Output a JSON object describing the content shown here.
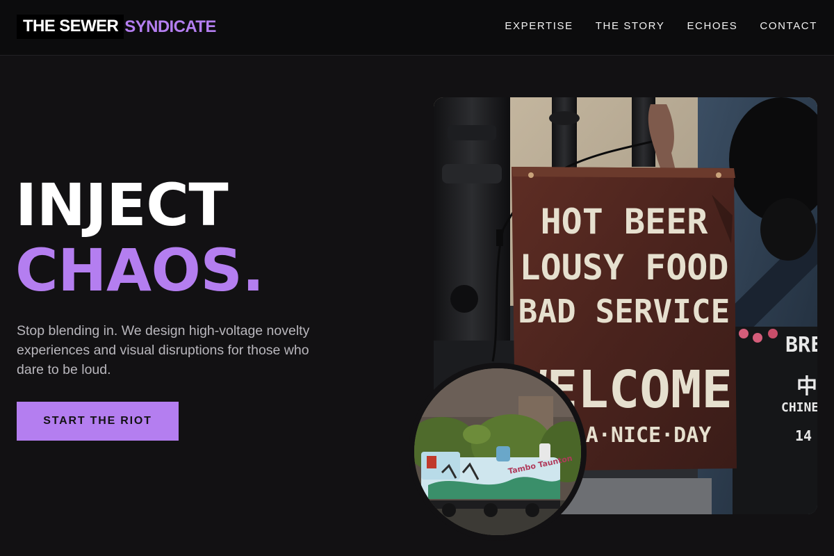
{
  "brand": {
    "name_part1": "THE SEWER",
    "name_part2": "SYNDICATE",
    "accent_color": "#b47ef0"
  },
  "nav": {
    "items": [
      {
        "label": "EXPERTISE"
      },
      {
        "label": "THE STORY"
      },
      {
        "label": "ECHOES"
      },
      {
        "label": "CONTACT"
      }
    ]
  },
  "hero": {
    "title_line1": "INJECT",
    "title_line2": "CHAOS.",
    "subtitle": "Stop blending in. We design high-voltage novelty experiences and visual disruptions for those who dare to be loud.",
    "cta_label": "START THE RIOT"
  },
  "main_photo": {
    "sign_lines": [
      "HOT BEER",
      "LOUSY FOOD",
      "BAD SERVICE",
      "WELCOME",
      "·A·NICE·DAY"
    ],
    "side_text": [
      "BRE",
      "中",
      "CHINE",
      "14"
    ]
  },
  "inset_photo": {
    "train_text": "Tambo Taunton"
  }
}
